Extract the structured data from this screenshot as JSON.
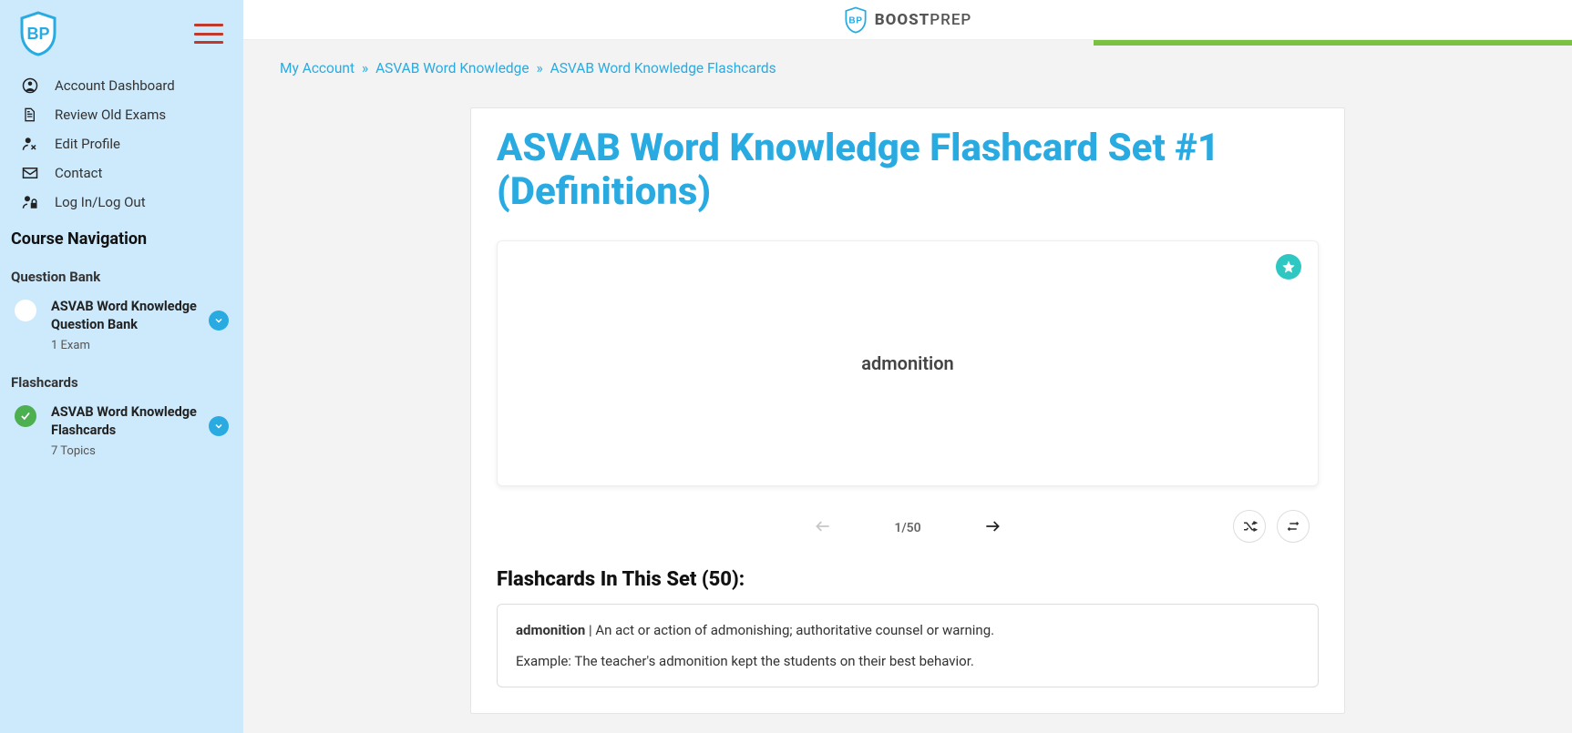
{
  "brand": {
    "bold": "BOOST",
    "light": "PREP"
  },
  "sidebar": {
    "nav": [
      {
        "label": "Account Dashboard"
      },
      {
        "label": "Review Old Exams"
      },
      {
        "label": "Edit Profile"
      },
      {
        "label": "Contact"
      },
      {
        "label": "Log In/Log Out"
      }
    ],
    "section_heading": "Course Navigation",
    "groups": [
      {
        "heading": "Question Bank",
        "item_title": "ASVAB Word Knowledge Question Bank",
        "item_meta": "1 Exam",
        "status": "open"
      },
      {
        "heading": "Flashcards",
        "item_title": "ASVAB Word Knowledge Flashcards",
        "item_meta": "7 Topics",
        "status": "done"
      }
    ]
  },
  "breadcrumb": {
    "a": "My Account",
    "b": "ASVAB Word Knowledge",
    "c": "ASVAB Word Knowledge Flashcards",
    "sep": "»"
  },
  "page_title": "ASVAB Word Knowledge Flashcard Set #1 (Definitions)",
  "flashcard": {
    "word": "admonition",
    "counter": "1/50"
  },
  "set_heading": "Flashcards In This Set (50):",
  "definition": {
    "term": "admonition",
    "sep": " | ",
    "text": "An act or action of admonishing; authoritative counsel or warning.",
    "example": "Example: The teacher's admonition kept the students on their best behavior."
  }
}
